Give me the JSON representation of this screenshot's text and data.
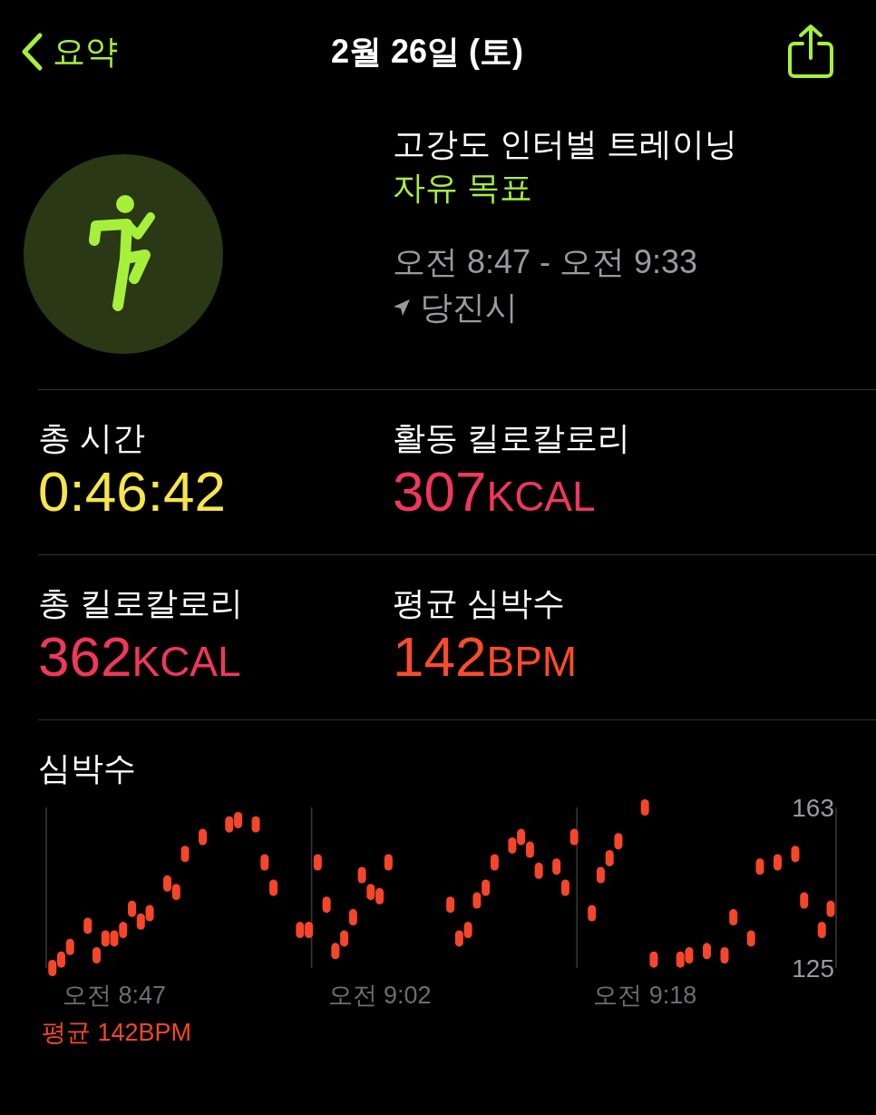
{
  "nav": {
    "back_label": "요약",
    "title": "2월 26일 (토)"
  },
  "workout": {
    "name": "고강도 인터벌 트레이닝",
    "goal": "자유 목표",
    "time_range": "오전 8:47 - 오전 9:33",
    "location": "당진시"
  },
  "metrics": [
    {
      "label": "총 시간",
      "value": "0:46:42",
      "color": "#f6e54b"
    },
    {
      "label": "활동 킬로칼로리",
      "value": "307",
      "unit": "KCAL",
      "color": "#f0375c"
    },
    {
      "label": "총 킬로칼로리",
      "value": "362",
      "unit": "KCAL",
      "color": "#f0375c"
    },
    {
      "label": "평균 심박수",
      "value": "142",
      "unit": "BPM",
      "color": "#fa4b2c"
    }
  ],
  "heart_rate": {
    "title": "심박수",
    "average": "평균 142BPM",
    "chart_data": {
      "type": "scatter",
      "ylim": [
        125,
        163
      ],
      "yticks": [
        125,
        163
      ],
      "categories": [
        null,
        null,
        null,
        null,
        null,
        null,
        null,
        null,
        "오전 8:47",
        null,
        null,
        null,
        null,
        null,
        null,
        null,
        null,
        null,
        null,
        null,
        null,
        null,
        null,
        null,
        null,
        null,
        null,
        null,
        null,
        null,
        null,
        null,
        null,
        null,
        null,
        null,
        null,
        null,
        "오전 9:02",
        null,
        null,
        null,
        null,
        null,
        null,
        null,
        null,
        null,
        null,
        null,
        null,
        null,
        null,
        null,
        null,
        null,
        null,
        null,
        null,
        null,
        null,
        null,
        null,
        null,
        null,
        null,
        null,
        null,
        "오전 9:18",
        null,
        null,
        null,
        null,
        null,
        null,
        null,
        null,
        null,
        null,
        null,
        null,
        null,
        null,
        null,
        null,
        null,
        null,
        null,
        null,
        null
      ],
      "series": [
        {
          "color": "#f5462a",
          "values": [
            null,
            125,
            127,
            130,
            null,
            135,
            128,
            132,
            132,
            134,
            139,
            136,
            138,
            null,
            145,
            143,
            152,
            null,
            156,
            null,
            null,
            159,
            160,
            null,
            159,
            150,
            144,
            null,
            null,
            134,
            134,
            150,
            140,
            129,
            132,
            137,
            147,
            143,
            142,
            150,
            null,
            null,
            null,
            null,
            null,
            null,
            140,
            132,
            134,
            141,
            144,
            150,
            null,
            154,
            156,
            153,
            148,
            null,
            149,
            144,
            156,
            null,
            138,
            147,
            151,
            155,
            null,
            null,
            163,
            127,
            null,
            null,
            127,
            128,
            null,
            129,
            null,
            128,
            137,
            null,
            132,
            149,
            null,
            150,
            null,
            152,
            141,
            null,
            134,
            139
          ]
        }
      ]
    }
  }
}
